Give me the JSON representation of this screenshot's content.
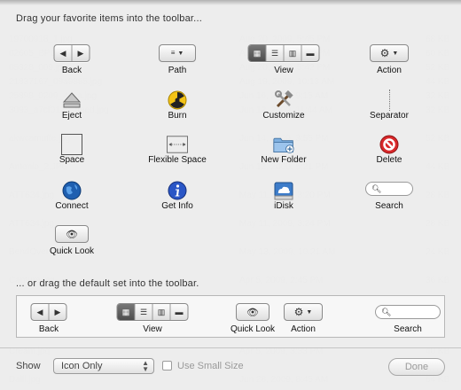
{
  "palette_heading": "Drag your favorite items into the toolbar...",
  "default_heading": "... or drag the default set into the toolbar.",
  "items": {
    "back": "Back",
    "path": "Path",
    "view": "View",
    "action": "Action",
    "eject": "Eject",
    "burn": "Burn",
    "customize": "Customize",
    "separator": "Separator",
    "space": "Space",
    "flexible_space": "Flexible Space",
    "new_folder": "New Folder",
    "delete": "Delete",
    "connect": "Connect",
    "get_info": "Get Info",
    "idisk": "iDisk",
    "search": "Search",
    "quick_look": "Quick Look"
  },
  "default_set": {
    "back": "Back",
    "view": "View",
    "quick_look": "Quick Look",
    "action": "Action",
    "search": "Search"
  },
  "footer": {
    "show_label": "Show",
    "show_value": "Icon Only",
    "small_size_label": "Use Small Size",
    "small_size_checked": false,
    "done_label": "Done"
  },
  "colors": {
    "burn_yellow": "#f3c316",
    "folder_blue": "#7fb0e0",
    "delete_red": "#d8282a",
    "info_blue": "#2a56c6",
    "connect_blue": "#1f5fb0"
  }
}
